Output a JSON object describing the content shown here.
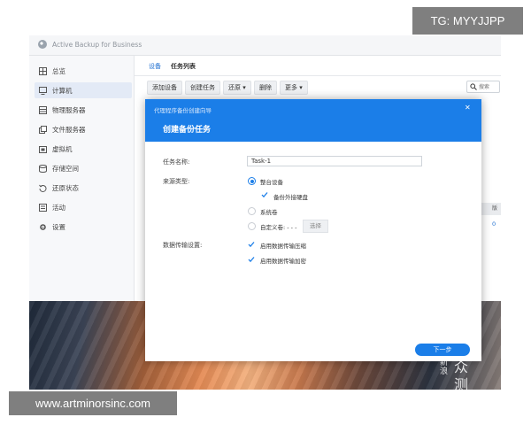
{
  "app": {
    "title": "Active Backup for Business"
  },
  "sidebar": {
    "items": [
      {
        "label": "总览",
        "icon": "overview-icon"
      },
      {
        "label": "计算机",
        "icon": "computer-icon"
      },
      {
        "label": "物理服务器",
        "icon": "physical-server-icon"
      },
      {
        "label": "文件服务器",
        "icon": "file-server-icon"
      },
      {
        "label": "虚拟机",
        "icon": "virtual-machine-icon"
      },
      {
        "label": "存储空间",
        "icon": "storage-icon"
      },
      {
        "label": "还原状态",
        "icon": "restore-status-icon"
      },
      {
        "label": "活动",
        "icon": "activity-icon"
      },
      {
        "label": "设置",
        "icon": "settings-gear-icon"
      }
    ],
    "active_index": 1
  },
  "main": {
    "tabs": [
      {
        "label": "设备"
      },
      {
        "label": "任务列表"
      }
    ],
    "toolbar": {
      "add_device": "添加设备",
      "create_task": "创建任务",
      "restore": "还原 ▾",
      "delete": "删除",
      "more": "更多 ▾"
    },
    "search": {
      "placeholder": "搜索"
    },
    "right_column_header": "版",
    "right_column_value": "0"
  },
  "dialog": {
    "window_title": "代理程序备份创建向导",
    "heading": "创建备份任务",
    "task_name_label": "任务名称:",
    "task_name_value": "Task-1",
    "source_type_label": "来源类型:",
    "options": {
      "whole_device": "整台设备",
      "external_drive": "备份外接硬盘",
      "system_volume": "系统卷",
      "custom_volume": "自定义卷: - - -"
    },
    "select_button": "选择",
    "transfer_label": "数据传输设置:",
    "enable_compression": "启用数据传输压缩",
    "enable_encryption": "启用数据传输加密",
    "next_button": "下一步",
    "close_icon": "close-icon"
  },
  "watermarks": {
    "tg": "TG: MYYJJPP",
    "url": "www.artminorsinc.com",
    "logo_left": "新浪",
    "logo_right": "众测"
  },
  "colors": {
    "accent": "#1b7ee8",
    "header_blue": "#1b7ee8",
    "sidebar_active": "#e3eaf6",
    "watermark_bg": "#7f7f7f"
  }
}
